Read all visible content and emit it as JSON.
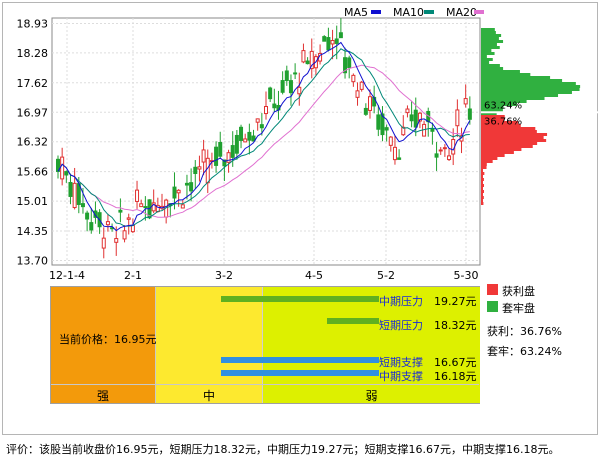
{
  "legend_ma": [
    "MA5",
    "MA10",
    "MA20"
  ],
  "colors": {
    "ma5": "#1010d0",
    "ma10": "#008878",
    "ma20": "#e070d0",
    "up": "#e03030",
    "down": "#20a030",
    "profit": "#f03838",
    "trapped": "#30b040",
    "support_bar": "#3090e0",
    "pressure_bar": "#60b020"
  },
  "chart_data": {
    "type": "candlestick",
    "title": "",
    "y_ticks": [
      "18.93",
      "18.28",
      "17.62",
      "16.97",
      "16.32",
      "15.66",
      "15.01",
      "14.35",
      "13.70"
    ],
    "ylim": [
      13.6,
      19.05
    ],
    "x_ticks": [
      "12-1-4",
      "2-1",
      "3-2",
      "4-5",
      "5-2",
      "5-30"
    ],
    "series": [
      "MA5",
      "MA10",
      "MA20"
    ],
    "chip_distribution": [
      {
        "name": "获利盘",
        "percent": "36.76%",
        "label": "36.76%"
      },
      {
        "name": "套牢盘",
        "percent": "63.24%",
        "label": "63.24%"
      }
    ]
  },
  "panel": {
    "current_price_label": "当前价格：16.95元",
    "zones": {
      "strong": "强",
      "mid": "中",
      "weak": "弱"
    },
    "levels": [
      {
        "label": "中期压力",
        "value": "19.27元"
      },
      {
        "label": "短期压力",
        "value": "18.32元"
      },
      {
        "label": "短期支撑",
        "value": "16.67元"
      },
      {
        "label": "中期支撑",
        "value": "16.18元"
      }
    ]
  },
  "legend_right": {
    "profit": "获利盘",
    "trapped": "套牢盘",
    "profit_ratio": "获利：36.76%",
    "trapped_ratio": "套牢：63.24%"
  },
  "evaluation": "评价：该股当前收盘价16.95元，短期压力18.32元，中期压力19.27元；短期支撑16.67元，中期支撑16.18元。"
}
